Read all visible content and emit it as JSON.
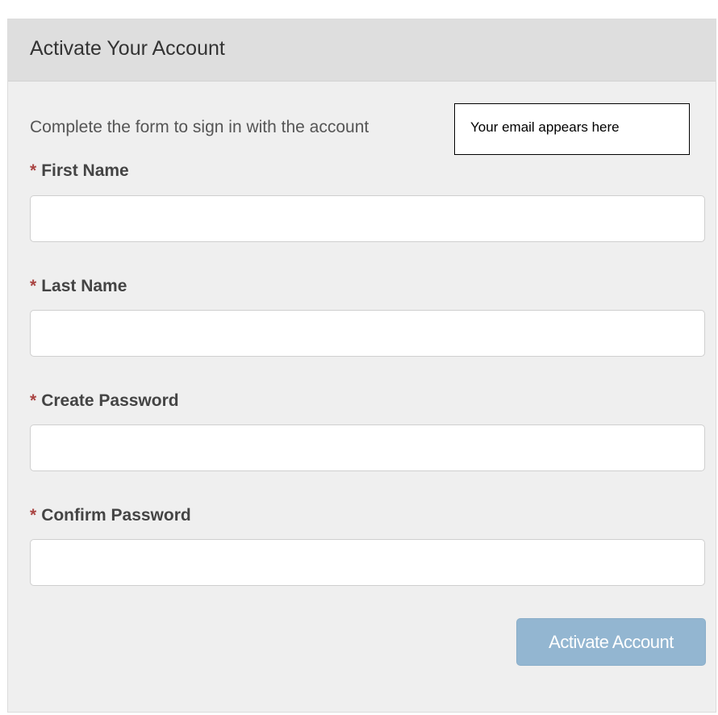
{
  "panel": {
    "title": "Activate Your Account"
  },
  "intro": {
    "text": "Complete the form to sign in with the account",
    "email_placeholder": "Your email appears here"
  },
  "form": {
    "required_marker": "*",
    "fields": [
      {
        "label": "First Name",
        "value": ""
      },
      {
        "label": "Last Name",
        "value": ""
      },
      {
        "label": "Create Password",
        "value": ""
      },
      {
        "label": "Confirm Password",
        "value": ""
      }
    ],
    "submit_label": "Activate Account"
  },
  "colors": {
    "panel_bg": "#efefef",
    "header_bg": "#dedede",
    "required": "#a94442",
    "button_bg": "#93b6d1"
  }
}
